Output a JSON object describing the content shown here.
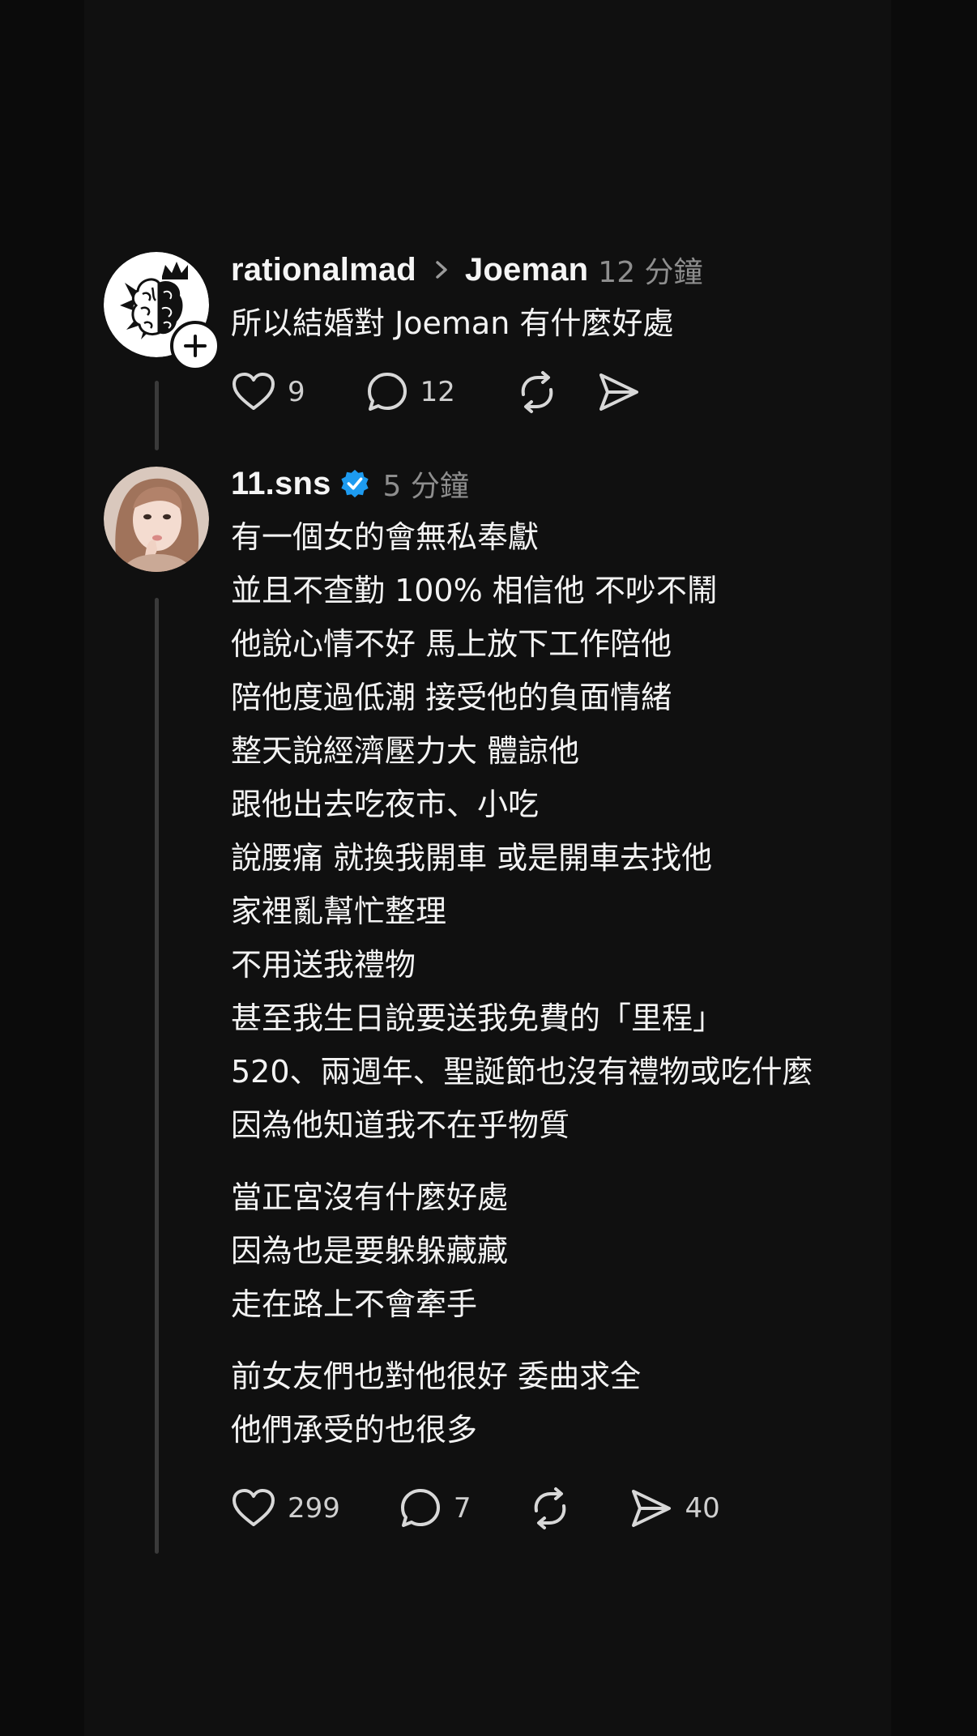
{
  "post1": {
    "username": "rationalmad",
    "reply_to": "Joeman",
    "time": "12 分鐘",
    "text": "所以結婚對 Joeman 有什麼好處",
    "likes": "9",
    "comments": "12"
  },
  "post2": {
    "username": "11.sns",
    "time": "5 分鐘",
    "paragraph1": "有一個女的會無私奉獻\n並且不查勤 100% 相信他 不吵不鬧\n他說心情不好 馬上放下工作陪他\n陪他度過低潮 接受他的負面情緒\n整天說經濟壓力大 體諒他\n跟他出去吃夜市、小吃\n說腰痛 就換我開車 或是開車去找他\n家裡亂幫忙整理\n不用送我禮物\n甚至我生日說要送我免費的「里程」\n520、兩週年、聖誕節也沒有禮物或吃什麼\n因為他知道我不在乎物質",
    "paragraph2": "當正宮沒有什麼好處\n因為也是要躲躲藏藏\n走在路上不會牽手",
    "paragraph3": "前女友們也對他很好 委曲求全\n他們承受的也很多",
    "likes": "299",
    "comments": "7",
    "shares": "40"
  },
  "colors": {
    "background": "#0b0b0b",
    "panel": "#101010",
    "verified": "#1d9bf0",
    "muted_text": "#8e8e8e"
  }
}
